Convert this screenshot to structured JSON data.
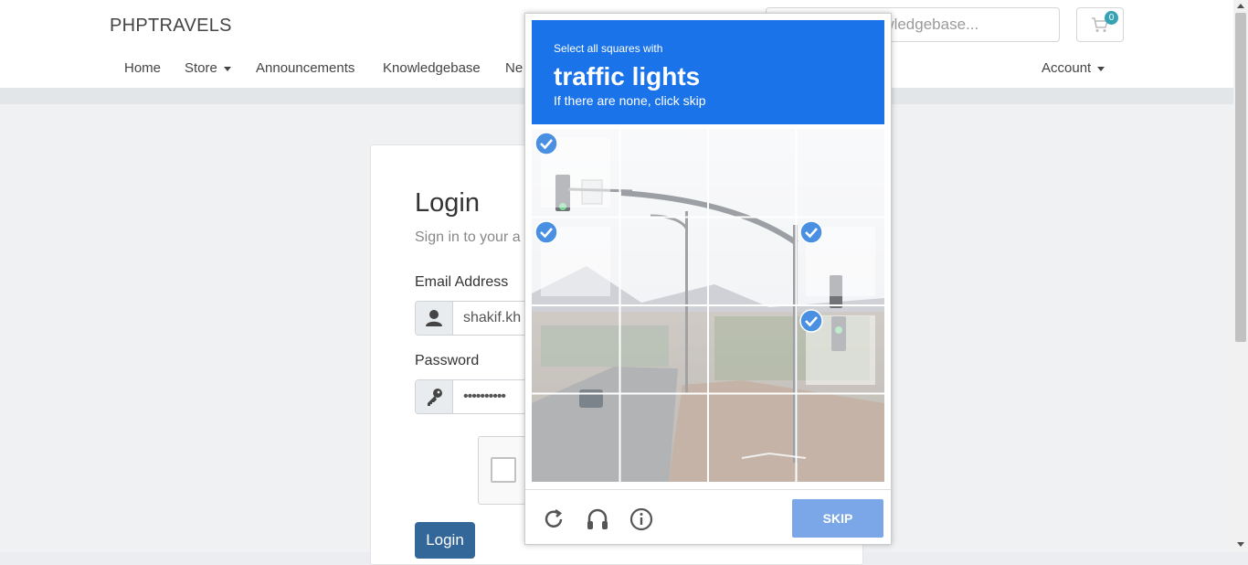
{
  "header": {
    "brand": "PHPTRAVELS",
    "search_placeholder": "Search our knowledgebase...",
    "cart_count": "0"
  },
  "nav": {
    "home": "Home",
    "store": "Store",
    "announcements": "Announcements",
    "knowledgebase": "Knowledgebase",
    "network": "Ne",
    "account": "Account"
  },
  "login": {
    "title": "Login",
    "subtitle": "Sign in to your a",
    "email_label": "Email Address",
    "email_value": "shakif.kh",
    "password_label": "Password",
    "password_value": "••••••••••",
    "button": "Login"
  },
  "captcha": {
    "line1": "Select all squares with",
    "line2": "traffic lights",
    "line3": "If there are none, click skip",
    "skip": "SKIP",
    "selected_tiles": [
      0,
      4,
      7,
      11
    ],
    "icons": [
      "reload-icon",
      "audio-icon",
      "info-icon"
    ]
  },
  "colors": {
    "captcha_blue": "#1a73e8",
    "skip_button": "#7ba7e9",
    "login_button": "#336699",
    "cart_badge": "#36a3b5",
    "check_blue": "#4a90e2"
  }
}
